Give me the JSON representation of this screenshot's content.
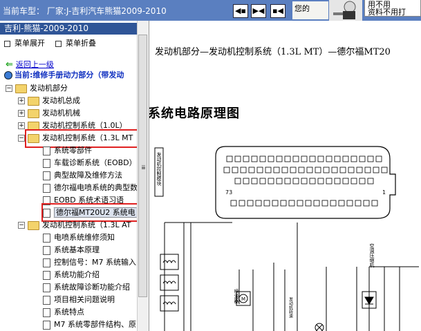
{
  "header": {
    "title": "当前车型： 厂家:J-吉利汽车熊猫2009-2010",
    "nav_buttons": [
      "◀▪",
      "▶◀",
      "▪◀"
    ],
    "user_hint": "您的",
    "note_lines": [
      "用不用",
      "资料不用打"
    ]
  },
  "sidebar": {
    "title": "吉利-熊猫-2009-2010",
    "expand_label": "菜单展开",
    "collapse_label": "菜单折叠",
    "back_label": "返回上一级",
    "current_label": "当前:维修手册动力部分（带发动",
    "tree": [
      {
        "label": "发动机部分",
        "type": "folder",
        "expander": "−"
      },
      {
        "label": "发动机总成",
        "type": "folder",
        "expander": "+"
      },
      {
        "label": "发动机机械",
        "type": "folder",
        "expander": "+"
      },
      {
        "label": "发动机控制系统（1.0L）",
        "type": "folder",
        "expander": "+"
      },
      {
        "label": "发动机控制系统（1.3L MT",
        "type": "folder",
        "expander": "−"
      },
      {
        "label": "系统零部件",
        "type": "doc"
      },
      {
        "label": "车载诊断系统（EOBD）",
        "type": "doc"
      },
      {
        "label": "典型故障及维修方法",
        "type": "doc"
      },
      {
        "label": "德尔福电喷系统的典型数",
        "type": "doc"
      },
      {
        "label": "EOBD 系统术语习语",
        "type": "doc"
      },
      {
        "label": "德尔福MT20U2 系统电",
        "type": "doc",
        "selected": true
      },
      {
        "label": "发动机控制系统（1.3L AT",
        "type": "folder",
        "expander": "−"
      },
      {
        "label": "电喷系统维修须知",
        "type": "doc"
      },
      {
        "label": "系统基本原理",
        "type": "doc"
      },
      {
        "label": "控制信号：M7 系统输入",
        "type": "doc"
      },
      {
        "label": "系统功能介绍",
        "type": "doc"
      },
      {
        "label": "系统故障诊断功能介绍",
        "type": "doc"
      },
      {
        "label": "项目相关问题说明",
        "type": "doc"
      },
      {
        "label": "系统特点",
        "type": "doc"
      },
      {
        "label": "M7 系统零部件结构、原",
        "type": "doc"
      }
    ]
  },
  "main": {
    "doc_title": "发动机部分—发动机控制系统（1.3L MT）—德尔福MT20",
    "diagram_title": "系统电路原理图",
    "diagram_labels": {
      "connector_left": "发动机控制模块",
      "engine_speed": "发动机转速",
      "ac_compressor": "空调压缩机",
      "injector": "喷油器",
      "pin_73": "73",
      "pin_1": "1"
    }
  },
  "colors": {
    "header_bg": "#5a7fc0",
    "sidebar_title_bg": "#2f5597",
    "highlight": "#e02020"
  }
}
